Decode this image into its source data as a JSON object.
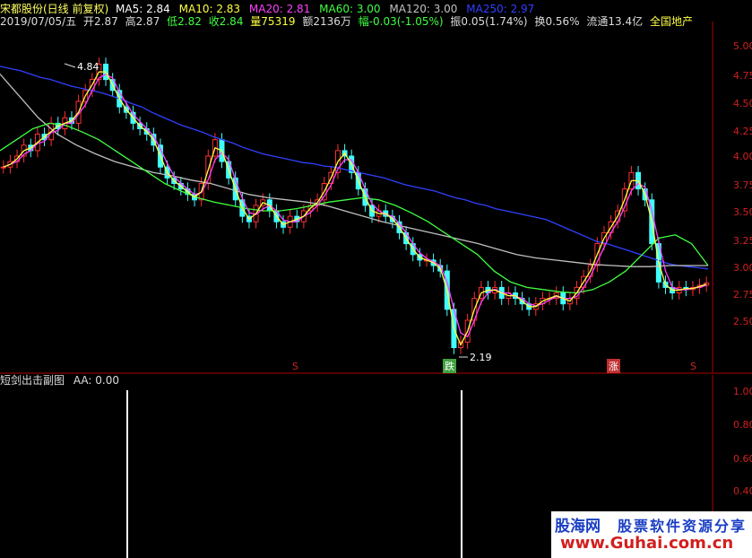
{
  "header": {
    "stock": "宋都股份(日线 前复权)",
    "ma5": {
      "label": "MA5: 2.84",
      "color": "#ffffff"
    },
    "ma10": {
      "label": "MA10: 2.83",
      "color": "#ffff40"
    },
    "ma20": {
      "label": "MA20: 2.81",
      "color": "#ff40ff"
    },
    "ma60": {
      "label": "MA60: 3.00",
      "color": "#40ff40"
    },
    "ma120": {
      "label": "MA120: 3.00",
      "color": "#c0c0c0"
    },
    "ma250": {
      "label": "MA250: 2.97",
      "color": "#3040ff"
    }
  },
  "quote": {
    "date": "2019/07/05/五",
    "open": "开2.87",
    "high": "高2.87",
    "low": "低2.82",
    "close": "收2.84",
    "volume": "量75319",
    "amount": "额2136万",
    "change": "幅-0.03(-1.05%)",
    "amplitude": "振0.05(1.74%)",
    "turnover": "换0.56%",
    "float": "流通13.4亿",
    "sector": "全国地产"
  },
  "price_axis": [
    "5.00",
    "4.75",
    "4.50",
    "4.25",
    "4.00",
    "3.75",
    "3.50",
    "3.25",
    "3.00",
    "2.75",
    "2.50"
  ],
  "annotations": {
    "high_label": "4.84",
    "low_label": "2.19",
    "signal_fall": "跌",
    "signal_rise": "涨",
    "signal_s1": "S",
    "signal_s2": "S"
  },
  "sub_panel": {
    "title": "短剑出击副图",
    "value": "AA: 0.00",
    "axis": [
      "1.00",
      "0.80",
      "0.60",
      "0.40"
    ]
  },
  "watermark": {
    "logo": "股海网",
    "title": "股票软件资源分享",
    "url": "www.Guhai.com.cn"
  },
  "colors": {
    "background": "#000000",
    "axis": "#b00000",
    "up": "#ff3030",
    "down": "#40ffff"
  },
  "chart_data": {
    "type": "candlestick",
    "ylim": [
      2.19,
      5.0
    ],
    "close_series": [
      3.9,
      3.95,
      4.0,
      4.1,
      4.05,
      4.2,
      4.15,
      4.3,
      4.25,
      4.35,
      4.3,
      4.5,
      4.6,
      4.7,
      4.84,
      4.7,
      4.6,
      4.45,
      4.4,
      4.3,
      4.25,
      4.2,
      4.1,
      3.9,
      3.8,
      3.75,
      3.7,
      3.65,
      3.6,
      3.75,
      4.0,
      4.15,
      3.95,
      3.8,
      3.6,
      3.45,
      3.4,
      3.55,
      3.6,
      3.5,
      3.4,
      3.35,
      3.45,
      3.4,
      3.5,
      3.55,
      3.6,
      3.75,
      3.85,
      4.05,
      4.0,
      3.85,
      3.7,
      3.55,
      3.45,
      3.5,
      3.45,
      3.4,
      3.3,
      3.2,
      3.1,
      3.05,
      3.05,
      3.0,
      2.95,
      2.6,
      2.25,
      2.3,
      2.5,
      2.7,
      2.8,
      2.75,
      2.8,
      2.7,
      2.75,
      2.7,
      2.65,
      2.6,
      2.65,
      2.7,
      2.7,
      2.75,
      2.65,
      2.7,
      2.8,
      2.9,
      3.0,
      3.2,
      3.3,
      3.4,
      3.5,
      3.7,
      3.85,
      3.7,
      3.6,
      3.2,
      2.85,
      2.8,
      2.75,
      2.8,
      2.78,
      2.8,
      2.82,
      2.84
    ],
    "ma250": [
      4.82,
      4.8,
      4.78,
      4.75,
      4.72,
      4.7,
      4.67,
      4.64,
      4.62,
      4.6,
      4.58,
      4.55,
      4.52,
      4.48,
      4.45,
      4.4,
      4.36,
      4.32,
      4.28,
      4.25,
      4.22,
      4.18,
      4.15,
      4.12,
      4.08,
      4.05,
      4.02,
      4.0,
      3.98,
      3.96,
      3.94,
      3.93,
      3.91,
      3.9,
      3.88,
      3.86,
      3.84,
      3.82,
      3.8,
      3.77,
      3.74,
      3.72,
      3.7,
      3.68,
      3.65,
      3.62,
      3.6,
      3.57,
      3.55,
      3.52,
      3.5,
      3.48,
      3.46,
      3.44,
      3.42,
      3.38,
      3.34,
      3.3,
      3.26,
      3.22,
      3.2,
      3.17,
      3.14,
      3.11,
      3.08,
      3.05,
      3.02,
      3.0,
      2.99,
      2.98,
      2.97
    ],
    "ma120": [
      4.75,
      4.55,
      4.35,
      4.2,
      4.1,
      4.02,
      3.95,
      3.9,
      3.85,
      3.82,
      3.78,
      3.75,
      3.7,
      3.65,
      3.62,
      3.6,
      3.58,
      3.55,
      3.5,
      3.45,
      3.4,
      3.36,
      3.32,
      3.28,
      3.24,
      3.2,
      3.15,
      3.1,
      3.07,
      3.05,
      3.03,
      3.01,
      3.0,
      2.99,
      2.99,
      3.0,
      3.0,
      3.0
    ],
    "ma60": [
      4.05,
      4.15,
      4.25,
      4.3,
      4.28,
      4.22,
      4.15,
      4.05,
      3.95,
      3.85,
      3.75,
      3.68,
      3.62,
      3.58,
      3.55,
      3.52,
      3.5,
      3.5,
      3.52,
      3.55,
      3.58,
      3.6,
      3.62,
      3.6,
      3.55,
      3.48,
      3.4,
      3.3,
      3.2,
      3.1,
      2.95,
      2.85,
      2.8,
      2.78,
      2.76,
      2.75,
      2.78,
      2.85,
      2.95,
      3.1,
      3.25,
      3.28,
      3.2,
      3.0
    ]
  }
}
